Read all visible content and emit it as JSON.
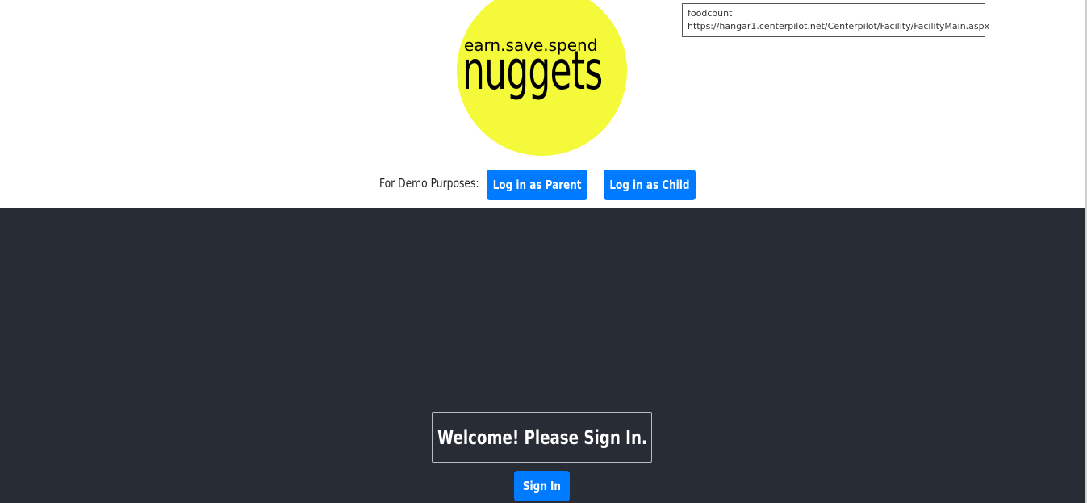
{
  "logo": {
    "tagline": "earn.save.spend",
    "wordmark": "nuggets",
    "circle_color": "#f4f93a"
  },
  "tooltip": {
    "line1": "foodcount",
    "line2": "https://hangar1.centerpilot.net/Centerpilot/Facility/FacilityMain.aspx"
  },
  "demo": {
    "label": "For Demo Purposes:",
    "parent_button": "Log in as Parent",
    "child_button": "Log in as Child"
  },
  "main": {
    "welcome": "Welcome! Please Sign In.",
    "signin_button": "Sign In"
  },
  "colors": {
    "accent": "#007bff",
    "dark_bg": "#282c34"
  }
}
